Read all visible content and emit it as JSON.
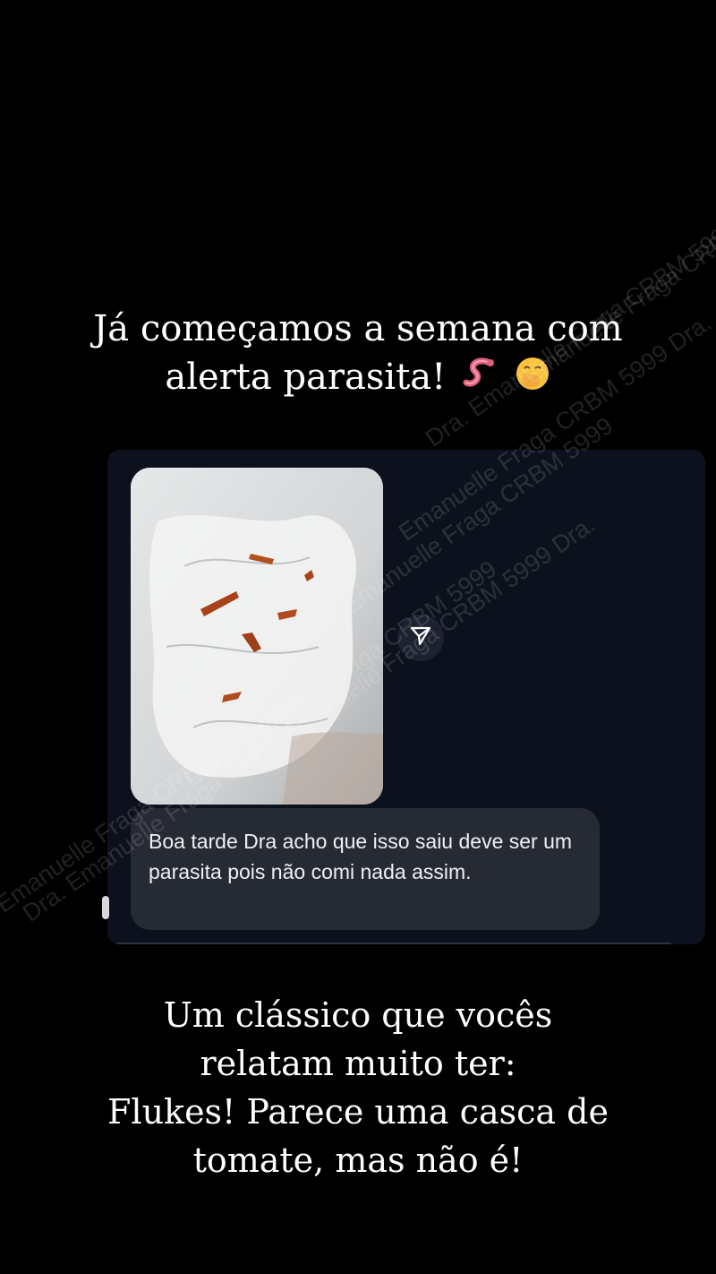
{
  "caption_top": {
    "line1": "Já começamos a semana com",
    "line2": "alerta parasita!",
    "emojis": [
      "worm-icon",
      "face-with-hand-over-mouth-icon"
    ]
  },
  "message": {
    "text": "Boa tarde Dra acho que isso saiu deve ser um parasita pois não comi nada assim."
  },
  "watermark": {
    "text1": "Emanuelle Fraga CRBM 5999 Dra.",
    "text2": "Dra. Emanuelle Fraga CRBM 5999"
  },
  "caption_bottom": {
    "line1": "Um clássico que vocês",
    "line2": "relatam muito ter:",
    "line3": "Flukes! Parece uma casca de",
    "line4": "tomate, mas não é!"
  },
  "colors": {
    "background": "#000000",
    "chat_panel": "#0c111d",
    "bubble": "#262a33",
    "text": "#ffffff"
  }
}
